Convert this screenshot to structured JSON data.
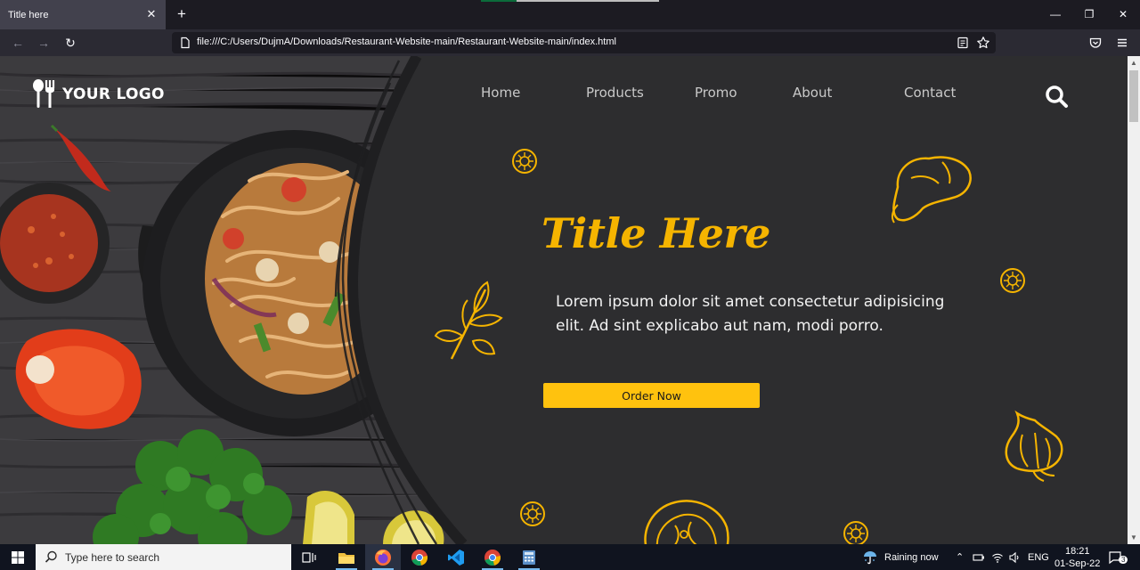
{
  "browser": {
    "tab": {
      "title": "Title here",
      "close_glyph": "✕"
    },
    "new_tab_glyph": "+",
    "window_controls": {
      "minimize": "—",
      "restore": "❐",
      "close": "✕"
    },
    "nav": {
      "back": "←",
      "forward": "→",
      "reload": "↻"
    },
    "url": "file:///C:/Users/DujmA/Downloads/Restaurant-Website-main/Restaurant-Website-main/index.html",
    "icons": [
      "page-icon",
      "reader-view-icon",
      "bookmark-star-icon",
      "pocket-icon",
      "menu-hamburger-icon"
    ]
  },
  "site": {
    "logo_text": "YOUR LOGO",
    "menu": [
      "Home",
      "Products",
      "Promo",
      "About",
      "Contact"
    ],
    "hero": {
      "title": "Title Here",
      "text": "Lorem ipsum dolor sit amet consectetur adipisicing elit. Ad sint explicabo aut nam, modi porro.",
      "cta": "Order Now"
    },
    "colors": {
      "accent": "#ffc20e",
      "title": "#f5b400",
      "panel": "#2d2d2f",
      "text": "#f2f2f2"
    }
  },
  "taskbar": {
    "search_placeholder": "Type here to search",
    "apps": [
      "task-view-icon",
      "file-explorer-icon",
      "firefox-icon",
      "chrome-icon",
      "vscode-icon",
      "chrome-alt-icon",
      "calculator-icon"
    ],
    "weather": "Raining now",
    "language": "ENG",
    "time": "18:21",
    "date": "01-Sep-22",
    "notification_count": "3"
  }
}
